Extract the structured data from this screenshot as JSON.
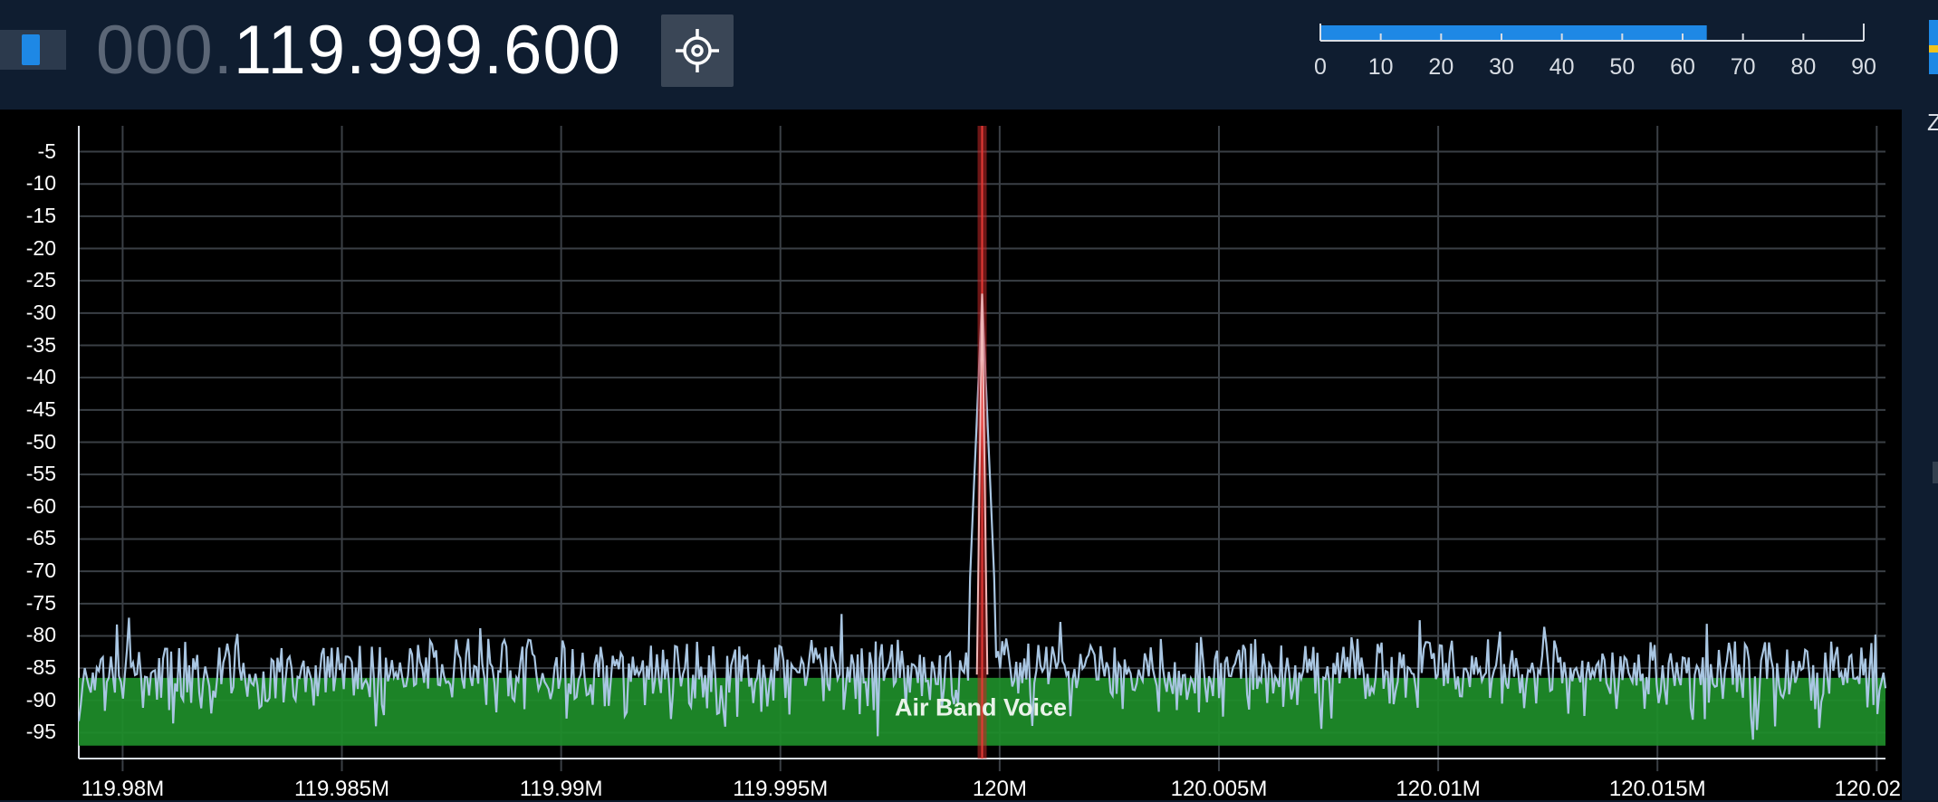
{
  "toolbar": {
    "frequency_prefix": "000.",
    "frequency_main": "119.999.600",
    "center_icon": "crosshair-icon",
    "left_toggle_icon": "panel-toggle-icon",
    "accent_color": "#1e88e5"
  },
  "signal_meter": {
    "ticks": [
      "0",
      "10",
      "20",
      "30",
      "40",
      "50",
      "60",
      "70",
      "80",
      "90"
    ],
    "level": 64,
    "max": 90,
    "bar_color": "#1e88e5"
  },
  "right_edge": {
    "clipped_text": "Z"
  },
  "chart_data": {
    "type": "line",
    "title": "",
    "xlabel": "",
    "ylabel": "",
    "y_ticks": [
      "-5",
      "-10",
      "-15",
      "-20",
      "-25",
      "-30",
      "-35",
      "-40",
      "-45",
      "-50",
      "-55",
      "-60",
      "-65",
      "-70",
      "-75",
      "-80",
      "-85",
      "-90",
      "-95"
    ],
    "ylim": [
      -99,
      -1
    ],
    "x_ticks": [
      "119.98M",
      "119.985M",
      "119.99M",
      "119.995M",
      "120M",
      "120.005M",
      "120.01M",
      "120.015M",
      "120.02M"
    ],
    "x_tick_values_mhz": [
      119.98,
      119.985,
      119.99,
      119.995,
      120.0,
      120.005,
      120.01,
      120.015,
      120.02
    ],
    "xlim_mhz": [
      119.979,
      120.0202
    ],
    "grid": true,
    "tuned_frequency_mhz": 119.9996,
    "peak": {
      "x_mhz": 119.9996,
      "y_db": -27
    },
    "noise_floor_db": [
      -87,
      -80
    ],
    "band": {
      "label": "Air Band Voice",
      "top_db": -86.5,
      "bottom_db": -97,
      "color": "#1e8e2a"
    },
    "trace_color": "#a9c6e2",
    "marker_color": "#c62828"
  }
}
